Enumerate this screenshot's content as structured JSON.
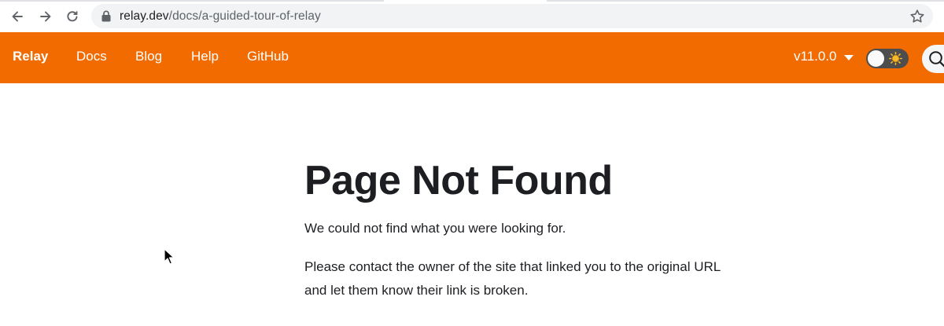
{
  "browser": {
    "url_domain": "relay.dev",
    "url_path": "/docs/a-guided-tour-of-relay",
    "icons": {
      "back": "back-arrow-icon",
      "forward": "forward-arrow-icon",
      "reload": "reload-icon",
      "lock": "lock-icon",
      "bookmark": "star-icon"
    }
  },
  "navbar": {
    "brand": "Relay",
    "links": [
      "Docs",
      "Blog",
      "Help",
      "GitHub"
    ],
    "version": "v11.0.0",
    "theme_toggle_icon": "sun-icon",
    "search_icon": "search-icon",
    "accent_color": "#f26b00"
  },
  "content": {
    "title": "Page Not Found",
    "paragraph_1": "We could not find what you were looking for.",
    "paragraph_2": "Please contact the owner of the site that linked you to the original URL and let them know their link is broken."
  }
}
